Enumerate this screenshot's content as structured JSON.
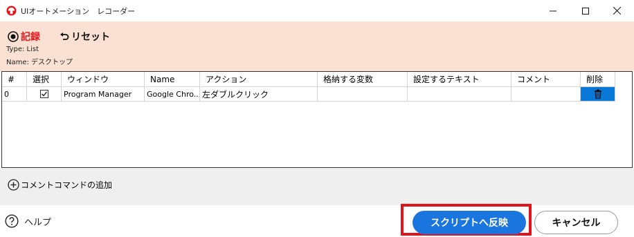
{
  "window": {
    "title": "UIオートメーション　レコーダー"
  },
  "toolbar": {
    "record_label": "記録",
    "reset_label": "リセット"
  },
  "info": {
    "type_line": "Type: List",
    "name_line": "Name: デスクトップ"
  },
  "grid": {
    "columns": [
      "#",
      "選択",
      "ウィンドウ",
      "Name",
      "アクション",
      "格納する変数",
      "設定するテキスト",
      "コメント",
      "削除"
    ],
    "rows": [
      {
        "index": "0",
        "selected": true,
        "window": "Program Manager",
        "name": "Google Chro...",
        "action": "左ダブルクリック",
        "variable": "",
        "text": "",
        "comment": ""
      }
    ]
  },
  "add_comment": {
    "label": "コメントコマンドの追加"
  },
  "footer": {
    "help_label": "ヘルプ",
    "apply_label": "スクリプトへ反映",
    "cancel_label": "キャンセル"
  },
  "colors": {
    "header_bg": "#fae1d3",
    "record_red": "#e8141b",
    "primary_blue": "#1a75de",
    "delete_cell_blue": "#0a78d7",
    "highlight_red": "#e3131c"
  }
}
